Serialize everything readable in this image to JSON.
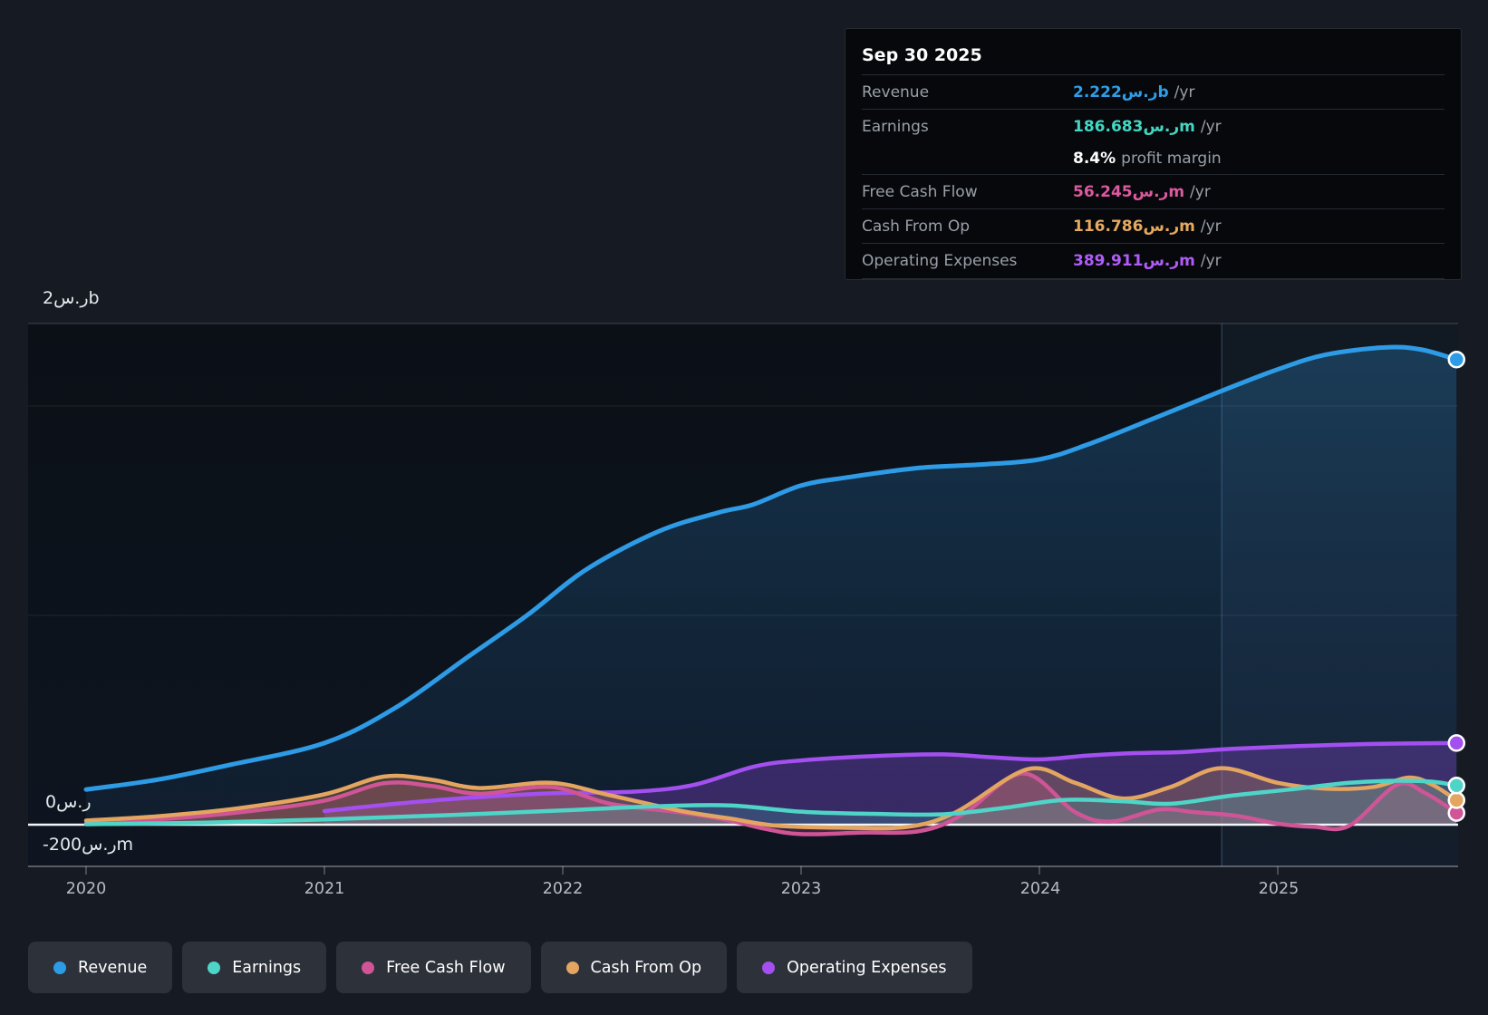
{
  "tooltip": {
    "date": "Sep 30 2025",
    "rows": [
      {
        "label": "Revenue",
        "value": "2.222ر.سb",
        "suffix": "/yr",
        "color": "#2f9ee8"
      },
      {
        "label": "Earnings",
        "value": "186.683ر.سm",
        "suffix": "/yr",
        "color": "#45d6c2"
      },
      {
        "label": "Free Cash Flow",
        "value": "56.245ر.سm",
        "suffix": "/yr",
        "color": "#dc5a9e"
      },
      {
        "label": "Cash From Op",
        "value": "116.786ر.سm",
        "suffix": "/yr",
        "color": "#e6a95e"
      },
      {
        "label": "Operating Expenses",
        "value": "389.911ر.سm",
        "suffix": "/yr",
        "color": "#b05cf5"
      }
    ],
    "profit_margin": {
      "value": "8.4%",
      "text": "profit margin"
    }
  },
  "y_axis": {
    "top_label": "2ر.سb",
    "zero_label": "0ر.س",
    "neg_label": "-200ر.سm"
  },
  "x_axis": {
    "years": [
      "2020",
      "2021",
      "2022",
      "2023",
      "2024",
      "2025"
    ]
  },
  "legend": [
    {
      "label": "Revenue",
      "color": "#2e9be6"
    },
    {
      "label": "Earnings",
      "color": "#4fd5c8"
    },
    {
      "label": "Free Cash Flow",
      "color": "#cf5596"
    },
    {
      "label": "Cash From Op",
      "color": "#e3a55f"
    },
    {
      "label": "Operating Expenses",
      "color": "#a44ff0"
    }
  ],
  "chart_data": {
    "type": "line",
    "title": "",
    "xlabel": "",
    "ylabel": "SAR",
    "x_domain": [
      2020,
      2025.75
    ],
    "x_tick_years": [
      2020,
      2021,
      2022,
      2023,
      2024,
      2025
    ],
    "y_unit": "SAR millions",
    "y_gridlines_m": [
      2000,
      1000
    ],
    "y_zero_line": true,
    "y_min_label_m": -200,
    "forecast_divider_t": 2024.765,
    "end_date": "Sep 30 2025",
    "legend_position": "bottom",
    "series": [
      {
        "name": "Revenue",
        "color": "#2e9be6",
        "fill": "revenueGrad",
        "end_value_m": 2222,
        "points": [
          [
            2020,
            168
          ],
          [
            2020.3,
            215
          ],
          [
            2020.6,
            285
          ],
          [
            2021,
            390
          ],
          [
            2021.3,
            560
          ],
          [
            2021.6,
            800
          ],
          [
            2021.85,
            1000
          ],
          [
            2022.1,
            1220
          ],
          [
            2022.4,
            1400
          ],
          [
            2022.65,
            1490
          ],
          [
            2022.8,
            1530
          ],
          [
            2023.0,
            1620
          ],
          [
            2023.2,
            1660
          ],
          [
            2023.5,
            1705
          ],
          [
            2023.75,
            1720
          ],
          [
            2024.0,
            1745
          ],
          [
            2024.2,
            1815
          ],
          [
            2024.5,
            1950
          ],
          [
            2024.76,
            2070
          ],
          [
            2025.0,
            2175
          ],
          [
            2025.2,
            2245
          ],
          [
            2025.45,
            2280
          ],
          [
            2025.6,
            2270
          ],
          [
            2025.75,
            2222
          ]
        ]
      },
      {
        "name": "Operating Expenses",
        "color": "#a44ff0",
        "fill": "rgba(150,70,230,0.30)",
        "end_value_m": 390,
        "points": [
          [
            2021.0,
            65
          ],
          [
            2021.3,
            100
          ],
          [
            2021.6,
            128
          ],
          [
            2021.95,
            150
          ],
          [
            2022.3,
            158
          ],
          [
            2022.55,
            190
          ],
          [
            2022.8,
            277
          ],
          [
            2023.0,
            307
          ],
          [
            2023.35,
            330
          ],
          [
            2023.6,
            336
          ],
          [
            2023.8,
            322
          ],
          [
            2024.0,
            312
          ],
          [
            2024.2,
            330
          ],
          [
            2024.4,
            342
          ],
          [
            2024.6,
            347
          ],
          [
            2024.8,
            362
          ],
          [
            2025.1,
            376
          ],
          [
            2025.4,
            386
          ],
          [
            2025.75,
            390
          ]
        ]
      },
      {
        "name": "Free Cash Flow",
        "color": "#cf5596",
        "fill": "rgba(205,80,150,0.26)",
        "end_value_m": 56,
        "points": [
          [
            2020,
            8
          ],
          [
            2020.3,
            25
          ],
          [
            2020.65,
            60
          ],
          [
            2021,
            115
          ],
          [
            2021.25,
            198
          ],
          [
            2021.45,
            185
          ],
          [
            2021.65,
            148
          ],
          [
            2021.95,
            180
          ],
          [
            2022.2,
            100
          ],
          [
            2022.5,
            58
          ],
          [
            2022.7,
            20
          ],
          [
            2022.85,
            -20
          ],
          [
            2023.0,
            -45
          ],
          [
            2023.25,
            -38
          ],
          [
            2023.5,
            -30
          ],
          [
            2023.68,
            50
          ],
          [
            2023.93,
            245
          ],
          [
            2024.15,
            60
          ],
          [
            2024.3,
            15
          ],
          [
            2024.5,
            72
          ],
          [
            2024.65,
            60
          ],
          [
            2024.83,
            42
          ],
          [
            2025.0,
            5
          ],
          [
            2025.15,
            -10
          ],
          [
            2025.3,
            -5
          ],
          [
            2025.5,
            190
          ],
          [
            2025.62,
            150
          ],
          [
            2025.75,
            56
          ]
        ]
      },
      {
        "name": "Cash From Op",
        "color": "#e3a55f",
        "fill": "rgba(225,160,90,0.26)",
        "end_value_m": 117,
        "points": [
          [
            2020,
            20
          ],
          [
            2020.3,
            40
          ],
          [
            2020.65,
            80
          ],
          [
            2021,
            145
          ],
          [
            2021.25,
            230
          ],
          [
            2021.45,
            215
          ],
          [
            2021.65,
            175
          ],
          [
            2021.95,
            200
          ],
          [
            2022.2,
            140
          ],
          [
            2022.5,
            65
          ],
          [
            2022.7,
            30
          ],
          [
            2022.9,
            -5
          ],
          [
            2023.2,
            -15
          ],
          [
            2023.45,
            -10
          ],
          [
            2023.65,
            60
          ],
          [
            2023.95,
            265
          ],
          [
            2024.15,
            200
          ],
          [
            2024.35,
            125
          ],
          [
            2024.55,
            180
          ],
          [
            2024.76,
            270
          ],
          [
            2025.0,
            200
          ],
          [
            2025.2,
            172
          ],
          [
            2025.4,
            180
          ],
          [
            2025.55,
            225
          ],
          [
            2025.65,
            190
          ],
          [
            2025.75,
            117
          ]
        ]
      },
      {
        "name": "Earnings",
        "color": "#4fd5c8",
        "fill": "rgba(70,210,190,0.20)",
        "end_value_m": 187,
        "points": [
          [
            2020,
            2
          ],
          [
            2020.5,
            10
          ],
          [
            2021,
            25
          ],
          [
            2021.5,
            45
          ],
          [
            2022,
            68
          ],
          [
            2022.4,
            88
          ],
          [
            2022.7,
            92
          ],
          [
            2023,
            62
          ],
          [
            2023.3,
            52
          ],
          [
            2023.6,
            50
          ],
          [
            2023.85,
            80
          ],
          [
            2024.1,
            118
          ],
          [
            2024.35,
            112
          ],
          [
            2024.55,
            100
          ],
          [
            2024.8,
            138
          ],
          [
            2025.05,
            168
          ],
          [
            2025.3,
            200
          ],
          [
            2025.5,
            210
          ],
          [
            2025.65,
            205
          ],
          [
            2025.75,
            187
          ]
        ]
      }
    ]
  },
  "colors": {
    "page_bg": "#151a23",
    "plot_bg_top": "#0b1017",
    "plot_bg_bottom": "#0e1520",
    "zero_line": "#f2f5f7",
    "grid_strong": "rgba(255,255,255,0.14)",
    "grid_faint": "rgba(255,255,255,0.07)",
    "axis_line": "rgba(255,255,255,0.30)",
    "forecast_fill": "rgba(125,175,225,0.06)",
    "forecast_line": "rgba(150,190,230,0.28)"
  }
}
